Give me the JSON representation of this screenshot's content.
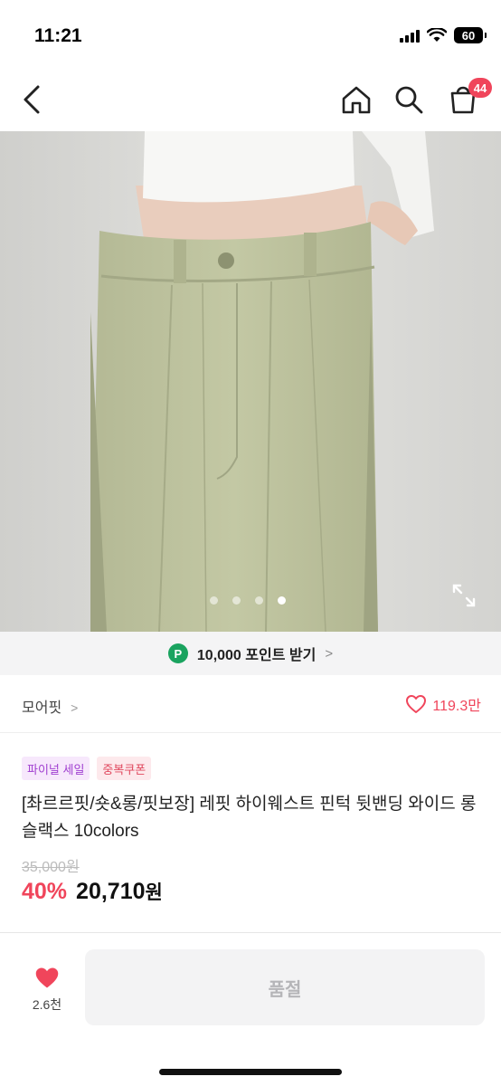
{
  "status": {
    "time": "11:21",
    "battery": "60"
  },
  "nav": {
    "cart_count": "44"
  },
  "image": {
    "total_slides": 4,
    "active_slide": 4
  },
  "points": {
    "icon": "P",
    "label": "10,000 포인트 받기",
    "chevron": ">"
  },
  "store": {
    "name": "모어핏",
    "chevron": ">",
    "likes": "119.3만"
  },
  "badges": {
    "final_sale": "파이널 세일",
    "coupon": "중복쿠폰"
  },
  "product": {
    "title": "[촤르르핏/숏&롱/핏보장] 레핏 하이웨스트 핀턱 뒷밴딩 와이드 롱 슬랙스 10colors",
    "original_price": "35,000원",
    "discount": "40%",
    "sale_price": "20,710",
    "currency": "원"
  },
  "bottom": {
    "wish_count": "2.6천",
    "soldout_label": "품절"
  },
  "colors": {
    "accent": "#f0455b",
    "points_green": "#1aa35f",
    "final_sale_purple": "#a03fd0"
  }
}
